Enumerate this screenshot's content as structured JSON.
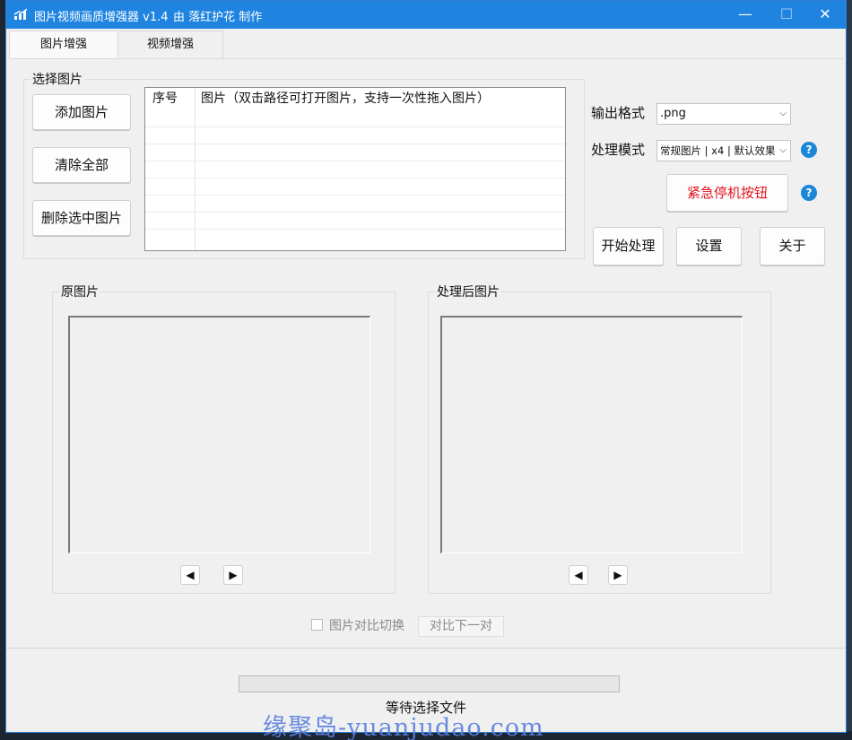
{
  "window": {
    "title": "图片视频画质增强器 v1.4",
    "author": "由 落红护花 制作",
    "minimize": "—",
    "maximize": "☐",
    "close": "✕"
  },
  "tabs": [
    {
      "label": "图片增强",
      "active": true
    },
    {
      "label": "视频增强",
      "active": false
    }
  ],
  "select_group": {
    "title": "选择图片",
    "buttons": {
      "add": "添加图片",
      "clear": "清除全部",
      "delete": "删除选中图片"
    },
    "table": {
      "headers": [
        "序号",
        "图片（双击路径可打开图片，支持一次性拖入图片）"
      ],
      "rows": []
    }
  },
  "options": {
    "format_label": "输出格式",
    "format_value": ".png",
    "mode_label": "处理模式",
    "mode_value": "常规图片 | x4 | 默认效果",
    "help_icon": "?",
    "emergency_button": "紧急停机按钮",
    "emergency_color": "#e0141e"
  },
  "actions": {
    "start": "开始处理",
    "settings": "设置",
    "about": "关于"
  },
  "preview": {
    "original_title": "原图片",
    "processed_title": "处理后图片",
    "prev_icon": "◀",
    "next_icon": "▶"
  },
  "compare": {
    "toggle_label": "图片对比切换",
    "next_pair_button": "对比下一对",
    "checked": false
  },
  "progress": {
    "value": 0
  },
  "status": "等待选择文件",
  "watermark": "缘聚岛-yuanjudao.com",
  "colors": {
    "titlebar": "#1f84e0",
    "help_icon": "#1c86d8",
    "progress_fill": "#06b025"
  }
}
